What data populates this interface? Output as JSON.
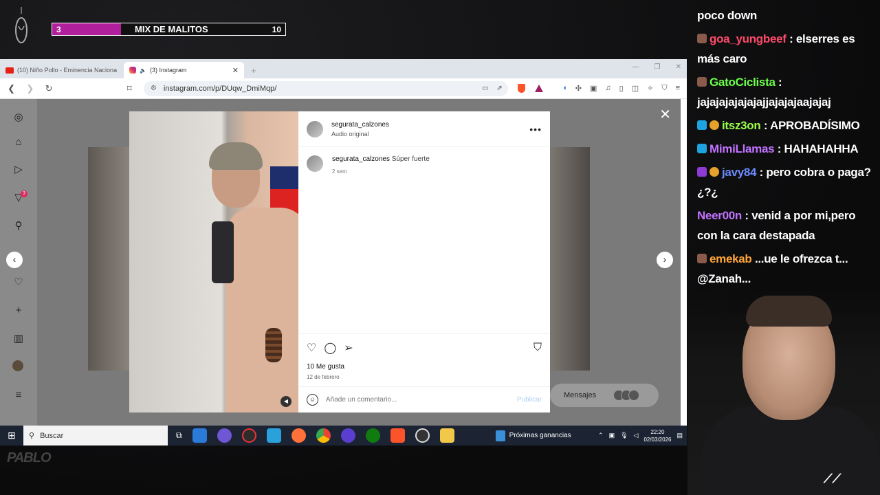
{
  "overlay": {
    "score_left": "3",
    "score_title": "MIX DE MALITOS",
    "score_right": "10",
    "accent_color": "#b21f9c"
  },
  "browser": {
    "tabs": [
      {
        "label": "(10) Niño Pollo - Eminencia Naciona",
        "icon": "youtube-icon"
      },
      {
        "label": "(3) Instagram",
        "icon": "instagram-icon"
      }
    ],
    "url": "instagram.com/p/DUqw_DmiMqp/"
  },
  "post": {
    "username": "segurata_calzones",
    "audio": "Audio original",
    "caption_user": "segurata_calzones",
    "caption_text": "Súper fuerte",
    "caption_time": "2 sem",
    "likes": "10 Me gusta",
    "date": "12 de febrero",
    "comment_placeholder": "Añade un comentario...",
    "publish_label": "Publicar"
  },
  "sidebar": {
    "notifications_badge": "3"
  },
  "messages_label": "Mensajes",
  "taskbar": {
    "search_label": "Buscar",
    "news_label": "Próximas ganancias",
    "time": "22:20",
    "date": "02/03/2026"
  },
  "chat": [
    {
      "user": "",
      "text": "poco down",
      "color": "#ffffff"
    },
    {
      "user": "goa_yungbeef",
      "text": " : elserres es más caro",
      "color": "#ff4a6a"
    },
    {
      "user": "GatoCiclista",
      "text": " : jajajajajajajajjajajajaajajaj",
      "color": "#6dff4a"
    },
    {
      "user": "itsz3on",
      "text": " : APROBADÍSIMO",
      "color": "#9cff4a"
    },
    {
      "user": "MimiLlamas",
      "text": " : HAHAHAHHA",
      "color": "#c073ff"
    },
    {
      "user": "javy84",
      "text": " : pero cobra o paga?¿?¿",
      "color": "#6b8bff"
    },
    {
      "user": "Neer00n",
      "text": " : venid a por mi,pero con la cara destapada",
      "color": "#c073ff"
    },
    {
      "user": "emekab",
      "text": " ...ue le ofrezca t... @Zanah...",
      "color": "#ffa63a"
    }
  ]
}
